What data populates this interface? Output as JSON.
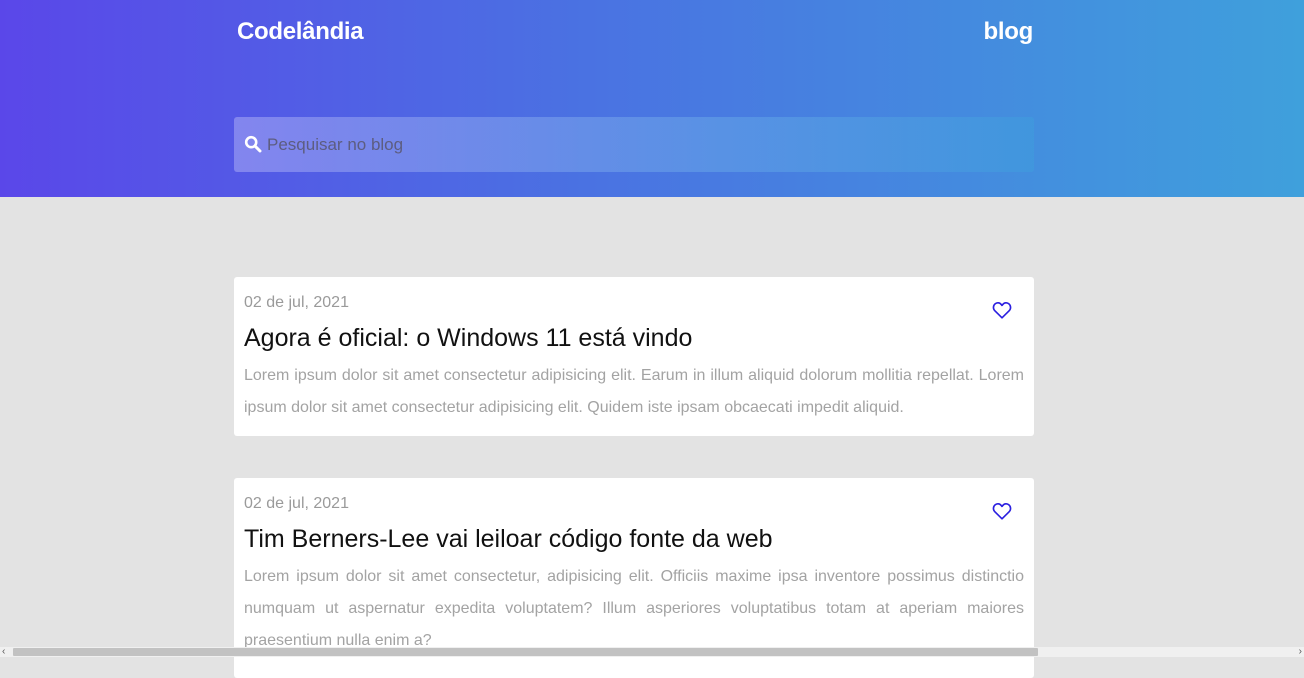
{
  "header": {
    "brand": "Codelândia",
    "nav_link": "blog",
    "search_placeholder": "Pesquisar no blog"
  },
  "posts": [
    {
      "date": "02 de jul, 2021",
      "title": "Agora é oficial: o Windows 11 está vindo",
      "excerpt": "Lorem ipsum dolor sit amet consectetur adipisicing elit. Earum in illum aliquid dolorum mollitia repellat. Lorem ipsum dolor sit amet consectetur adipisicing elit. Quidem iste ipsam obcaecati impedit aliquid.",
      "like_icon": "heart-outline-icon"
    },
    {
      "date": "02 de jul, 2021",
      "title": "Tim Berners-Lee vai leiloar código fonte da web",
      "excerpt": "Lorem ipsum dolor sit amet consectetur, adipisicing elit. Officiis maxime ipsa inventore possimus distinctio numquam ut aspernatur expedita voluptatem? Illum asperiores voluptatibus totam at aperiam maiores praesentium nulla enim a?",
      "like_icon": "heart-outline-icon"
    }
  ],
  "colors": {
    "header_gradient_start": "#5a47e9",
    "header_gradient_end": "#3fa0dc",
    "page_background": "#e3e3e3",
    "heart": "#2b1fe0"
  }
}
